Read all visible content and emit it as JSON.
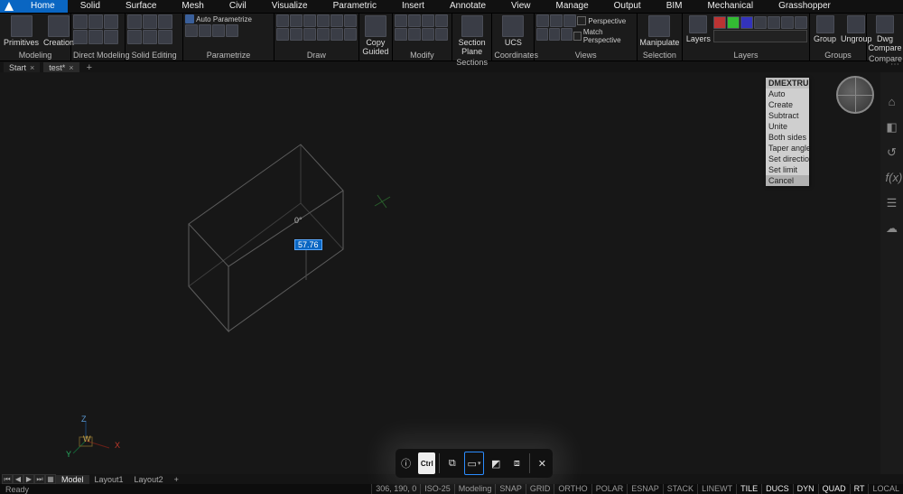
{
  "tabs": [
    "Home",
    "Solid",
    "Surface",
    "Mesh",
    "Civil",
    "Visualize",
    "Parametric",
    "Insert",
    "Annotate",
    "View",
    "Manage",
    "Output",
    "BIM",
    "Mechanical",
    "Grasshopper"
  ],
  "active_tab": "Home",
  "ribbon": {
    "modeling": {
      "label": "Modeling",
      "items": [
        "Primitives",
        "Creation"
      ]
    },
    "direct": {
      "label": "Direct Modeling"
    },
    "solidedit": {
      "label": "Solid Editing"
    },
    "parametrize": {
      "label": "Parametrize",
      "auto": "Auto Parametrize",
      "copy": "Copy\nGuided"
    },
    "draw": {
      "label": "Draw"
    },
    "modify": {
      "label": "Modify"
    },
    "sections": {
      "label": "Sections",
      "sp": "Section\nPlane"
    },
    "coords": {
      "label": "Coordinates",
      "ucs": "UCS"
    },
    "views": {
      "label": "Views",
      "persp": "Perspective",
      "match": "Match Perspective"
    },
    "selection": {
      "label": "Selection",
      "man": "Manipulate"
    },
    "layers": {
      "label": "Layers",
      "lay": "Layers"
    },
    "groups": {
      "label": "Groups",
      "g": "Group",
      "u": "Ungroup"
    },
    "compare": {
      "label": "Compare",
      "d": "Dwg\nCompare"
    }
  },
  "doc_tabs": {
    "t1": "Start",
    "t2": "test*",
    "active": "test*"
  },
  "ctx": {
    "title": "DMEXTRU…",
    "items": [
      "Auto",
      "Create",
      "Subtract",
      "Unite",
      "Both sides",
      "Taper angle",
      "Set direction",
      "Set limit",
      "Cancel"
    ],
    "sel": "Cancel"
  },
  "viewport": {
    "angle": "0°",
    "value": "57.76",
    "axis": {
      "x": "X",
      "y": "Y",
      "z": "Z",
      "w": "W"
    }
  },
  "popup": {
    "ctrl": "Ctrl"
  },
  "layout": {
    "model": "Model",
    "l1": "Layout1",
    "l2": "Layout2"
  },
  "status": {
    "ready": "Ready",
    "coords": "306, 190, 0",
    "std": "ISO-25",
    "sp": "Modeling",
    "toggles": [
      "SNAP",
      "GRID",
      "ORTHO",
      "POLAR",
      "ESNAP",
      "STACK",
      "LINEWT",
      "TILE",
      "DUCS",
      "DYN",
      "QUAD",
      "RT",
      "LOCAL"
    ]
  }
}
